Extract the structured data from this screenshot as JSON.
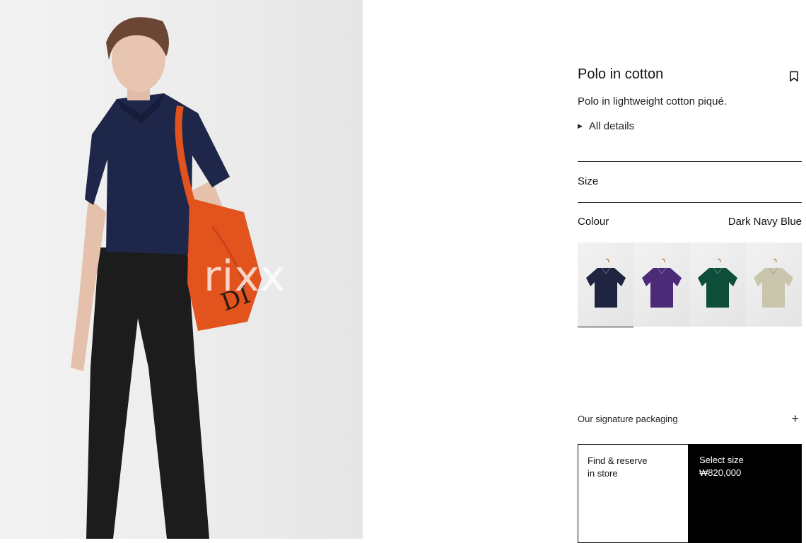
{
  "product": {
    "title": "Polo in cotton",
    "description": "Polo in lightweight cotton piqué.",
    "details_toggle": "All details"
  },
  "hero": {
    "watermark": "rixx"
  },
  "size": {
    "label": "Size"
  },
  "colour": {
    "label": "Colour",
    "selected": "Dark Navy Blue",
    "swatches": [
      {
        "color": "#1f2540",
        "name": "dark-navy-blue",
        "selected": true
      },
      {
        "color": "#4b2a78",
        "name": "purple",
        "selected": false
      },
      {
        "color": "#0d4d3a",
        "name": "green",
        "selected": false
      },
      {
        "color": "#c9c6ad",
        "name": "beige",
        "selected": false
      }
    ]
  },
  "packaging": {
    "label": "Our signature packaging"
  },
  "actions": {
    "reserve_line1": "Find & reserve",
    "reserve_line2": "in store",
    "select_label": "Select size",
    "price": "₩820,000"
  }
}
